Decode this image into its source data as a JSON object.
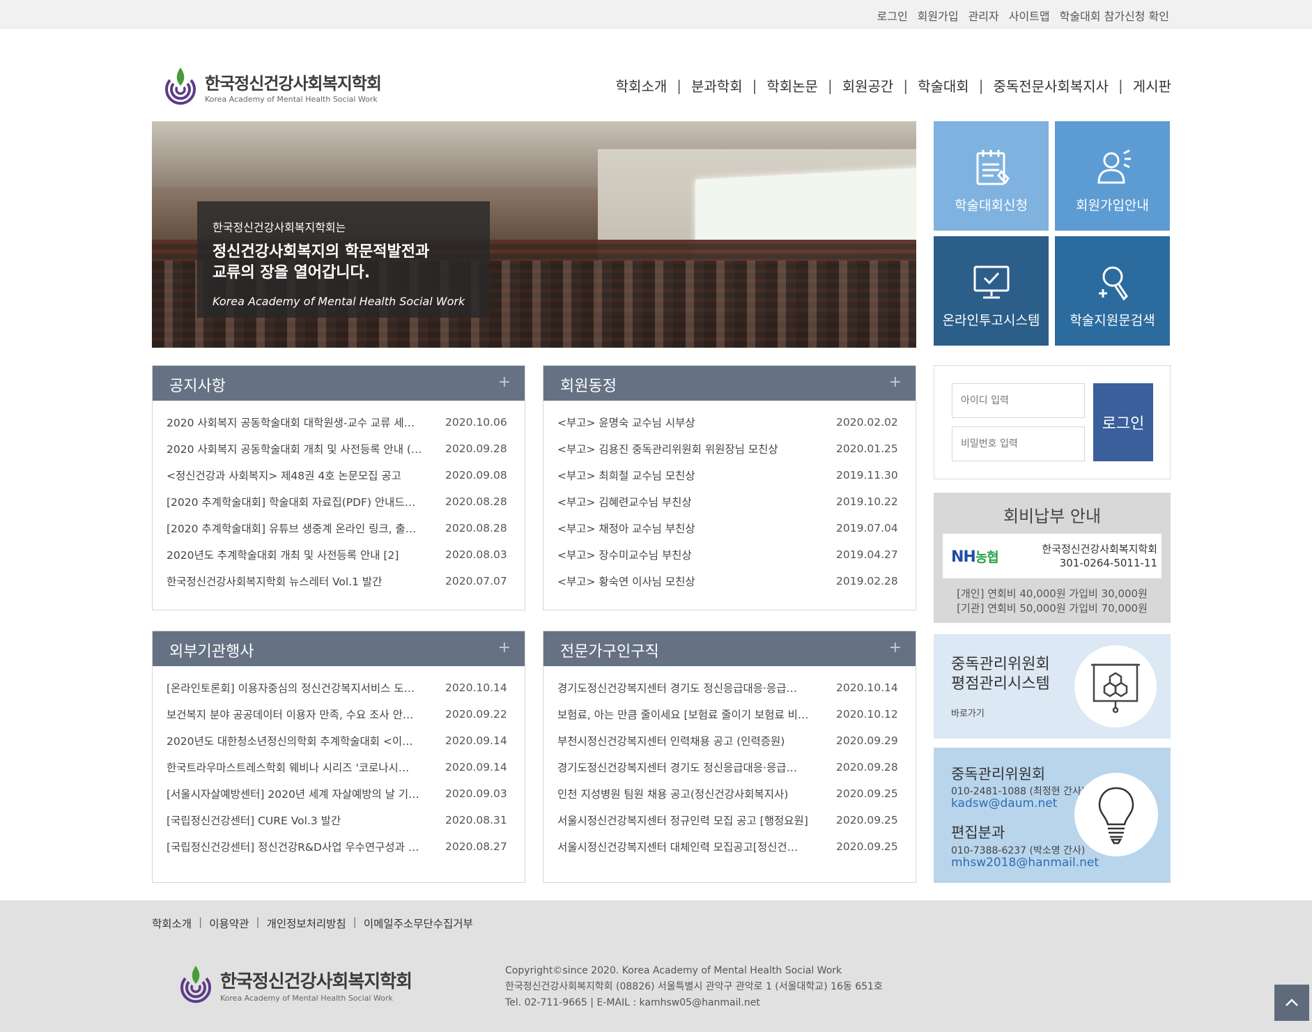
{
  "topbar": {
    "links": [
      "로그인",
      "회원가입",
      "관리자",
      "사이트맵",
      "학술대회 참가신청 확인"
    ]
  },
  "logo": {
    "title": "한국정신건강사회복지학회",
    "subtitle": "Korea Academy of Mental Health Social Work"
  },
  "gnb": [
    "학회소개",
    "분과학회",
    "학회논문",
    "회원공간",
    "학술대회",
    "중독전문사회복지사",
    "게시판"
  ],
  "hero": {
    "line1": "한국정신건강사회복지학회는",
    "line2": "정신건강사회복지의 학문적발전과",
    "line3": "교류의 장을 열어갑니다.",
    "line4": "Korea Academy of Mental Health Social Work"
  },
  "quick": [
    {
      "label": "학술대회신청",
      "icon": "calendar-icon"
    },
    {
      "label": "회원가입안내",
      "icon": "user-icon"
    },
    {
      "label": "온라인투고시스템",
      "icon": "monitor-check-icon"
    },
    {
      "label": "학술지원문검색",
      "icon": "search-icon"
    }
  ],
  "boards": {
    "notice": {
      "title": "공지사항",
      "items": [
        {
          "t": "2020 사회복지 공동학술대회 대학원생-교수 교류 세…",
          "d": "2020.10.06"
        },
        {
          "t": "2020 사회복지 공동학술대회 개최 및 사전등록 안내 (…",
          "d": "2020.09.28"
        },
        {
          "t": "<정신건강과 사회복지> 제48권 4호 논문모집 공고",
          "d": "2020.09.08"
        },
        {
          "t": "[2020 추계학술대회] 학술대회 자료집(PDF) 안내드…",
          "d": "2020.08.28"
        },
        {
          "t": "[2020 추계학술대회] 유튜브 생중계 온라인 링크, 출…",
          "d": "2020.08.28"
        },
        {
          "t": "2020년도 추계학술대회 개최 및 사전등록 안내 [2]",
          "d": "2020.08.03"
        },
        {
          "t": "한국정신건강사회복지학회 뉴스레터 Vol.1 발간",
          "d": "2020.07.07"
        }
      ]
    },
    "members": {
      "title": "회원동정",
      "items": [
        {
          "t": "<부고> 윤명숙 교수님 시부상",
          "d": "2020.02.02"
        },
        {
          "t": "<부고> 김용진 중독관리위원회 위원장님 모친상",
          "d": "2020.01.25"
        },
        {
          "t": "<부고> 최희철 교수님 모친상",
          "d": "2019.11.30"
        },
        {
          "t": "<부고> 김혜련교수님 부친상",
          "d": "2019.10.22"
        },
        {
          "t": "<부고> 채정아 교수님 부친상",
          "d": "2019.07.04"
        },
        {
          "t": "<부고> 장수미교수님 부친상",
          "d": "2019.04.27"
        },
        {
          "t": "<부고> 황숙연 이사님 모친상",
          "d": "2019.02.28"
        }
      ]
    },
    "external": {
      "title": "외부기관행사",
      "items": [
        {
          "t": "[온라인토론회] 이용자중심의 정신건강복지서비스 도…",
          "d": "2020.10.14"
        },
        {
          "t": "보건복지 분야 공공데이터 이용자 만족, 수요 조사 안…",
          "d": "2020.09.22"
        },
        {
          "t": "2020년도 대한청소년정신의학회 추계학술대회 <이…",
          "d": "2020.09.14"
        },
        {
          "t": "한국트라우마스트레스학회 웨비나 시리즈 '코로나시…",
          "d": "2020.09.14"
        },
        {
          "t": "[서울시자살예방센터] 2020년 세계 자살예방의 날 기…",
          "d": "2020.09.03"
        },
        {
          "t": "[국립정신건강센터] CURE Vol.3 발간",
          "d": "2020.08.31"
        },
        {
          "t": "[국립정신건강센터] 정신건강R&D사업 우수연구성과 …",
          "d": "2020.08.27"
        }
      ]
    },
    "jobs": {
      "title": "전문가구인구직",
      "items": [
        {
          "t": "경기도정신건강복지센터 경기도 정신응급대응·응급…",
          "d": "2020.10.14"
        },
        {
          "t": "보험료, 아는 만큼 줄이세요 [보험료 줄이기 보험료 비…",
          "d": "2020.10.12"
        },
        {
          "t": "부천시정신건강복지센터 인력채용 공고 (인력증원)",
          "d": "2020.09.29"
        },
        {
          "t": "경기도정신건강복지센터 경기도 정신응급대응·응급…",
          "d": "2020.09.28"
        },
        {
          "t": "인천 지성병원 팀원 채용 공고(정신건강사회복지사)",
          "d": "2020.09.25"
        },
        {
          "t": "서울시정신건강복지센터 정규인력 모집 공고 [행정요원]",
          "d": "2020.09.25"
        },
        {
          "t": "서울시정신건강복지센터 대체인력 모집공고[정신건…",
          "d": "2020.09.25"
        }
      ]
    }
  },
  "login": {
    "id_placeholder": "아이디 입력",
    "pw_placeholder": "비밀번호 입력",
    "button": "로그인"
  },
  "fee": {
    "title": "회비납부 안내",
    "bank_name": "NH",
    "bank_name2": "농협",
    "account_holder": "한국정신건강사회복지학회",
    "account_no": "301-0264-5011-11",
    "fee_personal": "[개인] 연회비 40,000원 가입비 30,000원",
    "fee_org": "[기관] 연회비 50,000원 가입비 70,000원"
  },
  "committee1": {
    "line1": "중독관리위원회",
    "line2": "평점관리시스템",
    "go": "바로가기"
  },
  "committee2": {
    "h1": "중독관리위원회",
    "p1": "010-2481-1088 (최정현 간사)",
    "m1": "kadsw@daum.net",
    "h2": "편집분과",
    "p2": "010-7388-6237 (박소영 간사)",
    "m2": "mhsw2018@hanmail.net"
  },
  "footer": {
    "links": [
      "학회소개",
      "이용약관",
      "개인정보처리방침",
      "이메일주소무단수집거부"
    ],
    "copyright": "Copyright©since 2020. Korea Academy of Mental Health Social Work",
    "address": "한국정신건강사회복지학회 (08826) 서울특별시 관악구 관악로 1 (서울대학교) 16동 651호",
    "contact": "Tel. 02-711-9665 | E-MAIL : kamhsw05@hanmail.net"
  },
  "colors": {
    "board_head": "#667284",
    "login_btn": "#3a5f9a",
    "link_blue": "#2c6db3"
  }
}
